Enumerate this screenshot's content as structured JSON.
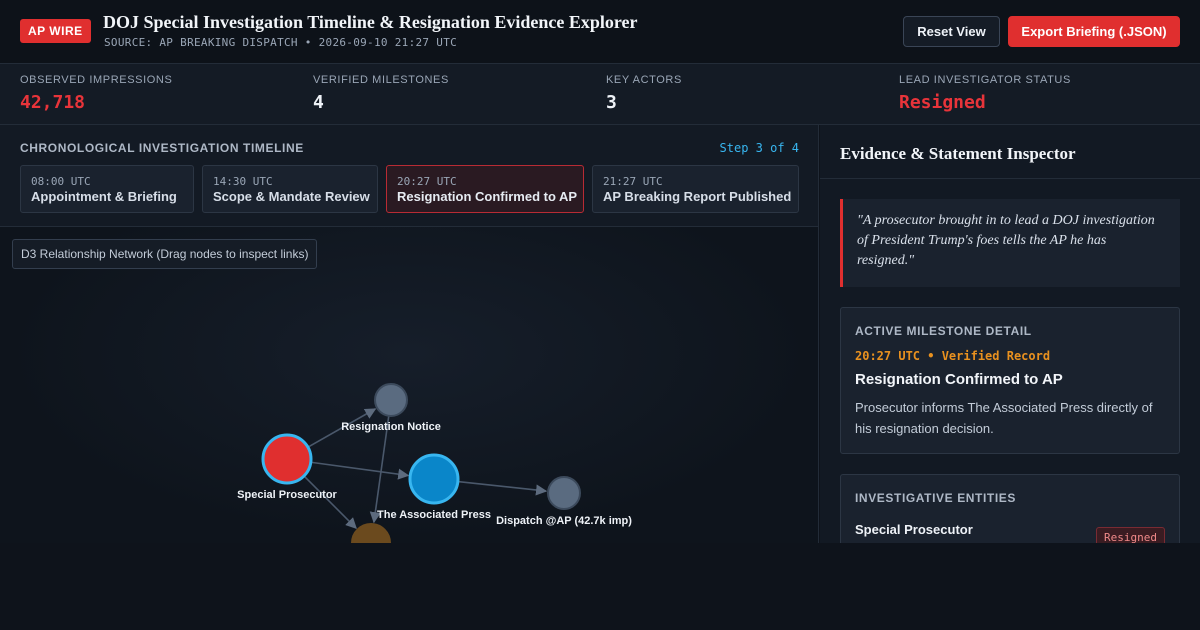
{
  "header": {
    "badge": "AP WIRE",
    "title": "DOJ Special Investigation Timeline & Resignation Evidence Explorer",
    "source": "SOURCE: AP BREAKING DISPATCH • 2026-09-10 21:27 UTC",
    "reset_label": "Reset View",
    "export_label": "Export Briefing (.JSON)"
  },
  "stats": [
    {
      "label": "OBSERVED IMPRESSIONS",
      "value": "42,718",
      "color": "#e8343a"
    },
    {
      "label": "VERIFIED MILESTONES",
      "value": "4",
      "color": "#eef2f7"
    },
    {
      "label": "KEY ACTORS",
      "value": "3",
      "color": "#eef2f7"
    },
    {
      "label": "LEAD INVESTIGATOR STATUS",
      "value": "Resigned",
      "color": "#e8343a"
    }
  ],
  "timeline": {
    "title": "CHRONOLOGICAL INVESTIGATION TIMELINE",
    "step": "Step 3 of 4",
    "active_index": 2,
    "items": [
      {
        "time": "08:00 UTC",
        "label": "Appointment & Briefing"
      },
      {
        "time": "14:30 UTC",
        "label": "Scope & Mandate Review"
      },
      {
        "time": "20:27 UTC",
        "label": "Resignation Confirmed to AP"
      },
      {
        "time": "21:27 UTC",
        "label": "AP Breaking Report Published"
      }
    ]
  },
  "graph": {
    "caption": "D3 Relationship Network (Drag nodes to inspect links)",
    "nodes": [
      {
        "id": "prosecutor",
        "label": "Special Prosecutor",
        "color": "#e02f2f",
        "stroke": "#38b6f0"
      },
      {
        "id": "notice",
        "label": "Resignation Notice",
        "color": "#5a6b80",
        "stroke": "#3c4a5c"
      },
      {
        "id": "ap",
        "label": "The Associated Press",
        "color": "#0a86c9",
        "stroke": "#38b6f0"
      },
      {
        "id": "dispatch",
        "label": "Dispatch @AP (42.7k imp)",
        "color": "#5a6b80",
        "stroke": "#3c4a5c"
      },
      {
        "id": "doj",
        "label": "",
        "color": "#6b4a1e",
        "stroke": "#6b4a1e"
      }
    ],
    "links": [
      {
        "source": "prosecutor",
        "target": "notice"
      },
      {
        "source": "prosecutor",
        "target": "ap"
      },
      {
        "source": "prosecutor",
        "target": "doj"
      },
      {
        "source": "ap",
        "target": "dispatch"
      },
      {
        "source": "notice",
        "target": "doj"
      }
    ]
  },
  "inspector": {
    "title": "Evidence & Statement Inspector",
    "quote": "\"A prosecutor brought in to lead a DOJ investigation of President Trump's foes tells the AP he has resigned.\"",
    "milestone": {
      "heading": "ACTIVE MILESTONE DETAIL",
      "meta": "20:27 UTC • Verified Record",
      "title": "Resignation Confirmed to AP",
      "description": "Prosecutor informs The Associated Press directly of his resignation decision."
    },
    "entities": {
      "heading": "INVESTIGATIVE ENTITIES",
      "items": [
        {
          "name": "Special Prosecutor",
          "status": "Resigned"
        }
      ]
    }
  }
}
